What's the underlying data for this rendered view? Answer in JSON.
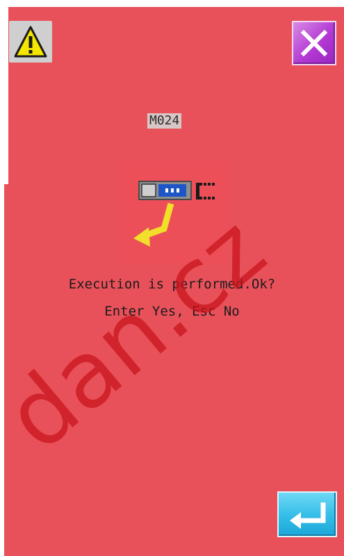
{
  "dialog": {
    "message_code": "M024",
    "prompt_line1": "Execution is performed.Ok?",
    "prompt_line2": "Enter Yes, Esc No",
    "icons": {
      "warning": "warning-triangle-icon",
      "close": "close-x-icon",
      "illustration": "execution-arrow-icon",
      "enter": "enter-return-icon"
    }
  },
  "watermark": {
    "text": "dan.cz"
  },
  "colors": {
    "background": "#e9515a",
    "close_button": "#b33ad3",
    "enter_button": "#37bfe9",
    "warning_button": "#cfcfcf",
    "warning_triangle": "#f3e600"
  }
}
